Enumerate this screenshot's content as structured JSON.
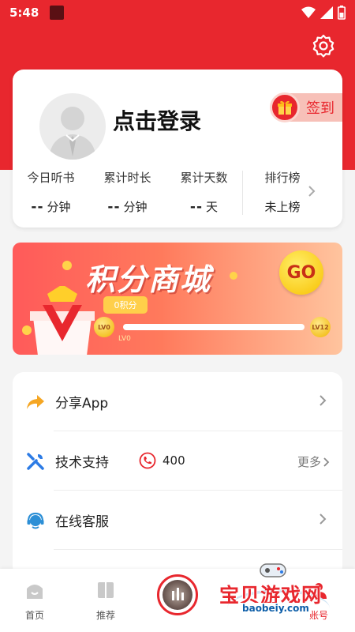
{
  "status_bar": {
    "time": "5:48"
  },
  "profile": {
    "login_prompt": "点击登录",
    "signin_label": "签到",
    "stats": [
      {
        "label": "今日听书",
        "value": "--",
        "unit": "分钟"
      },
      {
        "label": "累计时长",
        "value": "--",
        "unit": "分钟"
      },
      {
        "label": "累计天数",
        "value": "--",
        "unit": "天"
      }
    ],
    "rank": {
      "label": "排行榜",
      "value": "未上榜"
    }
  },
  "points_mall": {
    "title": "积分商城",
    "go_label": "GO",
    "points_bubble": "0积分",
    "level_start": "LV0",
    "level_end": "LV12",
    "level_caption": "LV0",
    "progress": 0
  },
  "menu": {
    "share": {
      "label": "分享App"
    },
    "support": {
      "label": "技术支持",
      "phone": "400",
      "more": "更多"
    },
    "service": {
      "label": "在线客服"
    }
  },
  "tabbar": {
    "home": "首页",
    "recommend": "推荐",
    "account": "账号"
  },
  "watermark": {
    "text": "宝贝游戏网",
    "url": "baobeiy.com"
  },
  "colors": {
    "brand_red": "#e8272e",
    "banner_gold": "#ffd44a",
    "text_gray": "#777777"
  },
  "icons": [
    "gear-icon",
    "gift-icon",
    "share-arrow-icon",
    "wrench-icon",
    "phone-icon",
    "headset-icon",
    "chevron-right-icon",
    "home-icon",
    "book-icon"
  ]
}
